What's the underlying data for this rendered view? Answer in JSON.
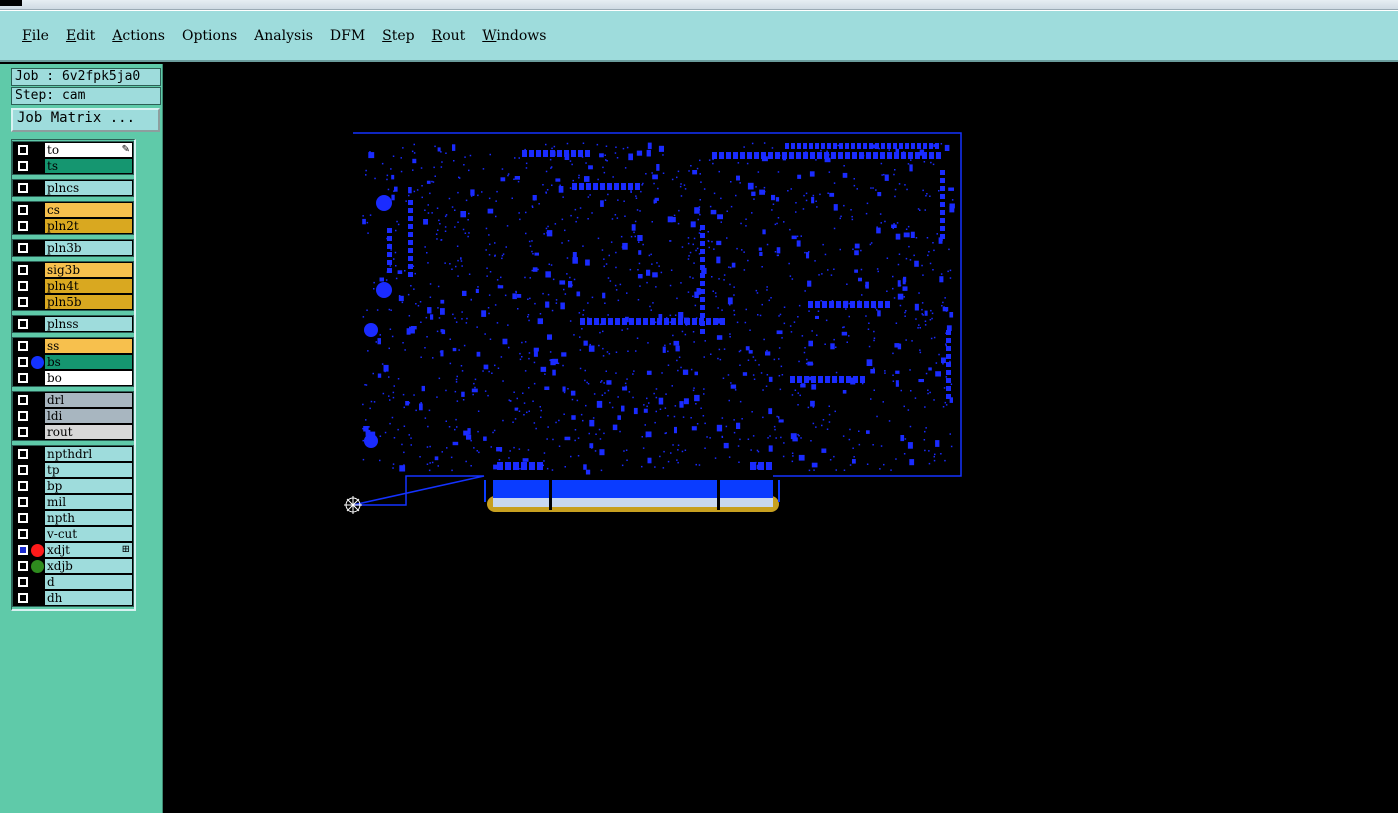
{
  "menu": [
    {
      "label": "File",
      "mnemonic": "F"
    },
    {
      "label": "Edit",
      "mnemonic": "E"
    },
    {
      "label": "Actions",
      "mnemonic": "A"
    },
    {
      "label": "Options",
      "mnemonic": ""
    },
    {
      "label": "Analysis",
      "mnemonic": ""
    },
    {
      "label": "DFM",
      "mnemonic": ""
    },
    {
      "label": "Step",
      "mnemonic": "S"
    },
    {
      "label": "Rout",
      "mnemonic": "R"
    },
    {
      "label": "Windows",
      "mnemonic": "W"
    }
  ],
  "job": {
    "text": "Job : 6v2fpk5ja0"
  },
  "step": {
    "text": "Step: cam"
  },
  "job_matrix_button": "Job Matrix ...",
  "colors": {
    "board_outline": "#1432ff",
    "features": "#1a2bff",
    "finger_gold": "#c7a020",
    "finger_fill": "#0a3cff",
    "finger_light": "#c8d8f0",
    "crosshair": "#ffffff"
  },
  "layer_groups": [
    [
      {
        "name": "to",
        "color": "#ffffff",
        "dot": "",
        "mark": "pen-icon"
      },
      {
        "name": "ts",
        "color": "#159670",
        "dot": ""
      }
    ],
    [
      {
        "name": "plncs",
        "color": "#9edcdc",
        "dot": ""
      }
    ],
    [
      {
        "name": "cs",
        "color": "#f7c04d",
        "dot": ""
      },
      {
        "name": "pln2t",
        "color": "#d9a820",
        "dot": ""
      }
    ],
    [
      {
        "name": "pln3b",
        "color": "#9edcdc",
        "dot": ""
      }
    ],
    [
      {
        "name": "sig3b",
        "color": "#f7c04d",
        "dot": ""
      },
      {
        "name": "pln4t",
        "color": "#d9a820",
        "dot": ""
      },
      {
        "name": "pln5b",
        "color": "#d9a820",
        "dot": ""
      }
    ],
    [
      {
        "name": "plnss",
        "color": "#9edcdc",
        "dot": ""
      }
    ],
    [
      {
        "name": "ss",
        "color": "#f7c04d",
        "dot": ""
      },
      {
        "name": "bs",
        "color": "#159670",
        "dot": "#1432ff"
      },
      {
        "name": "bo",
        "color": "#ffffff",
        "dot": ""
      }
    ],
    [
      {
        "name": "drl",
        "color": "#a8b6c0",
        "dot": ""
      },
      {
        "name": "ldi",
        "color": "#a8b6c0",
        "dot": ""
      },
      {
        "name": "rout",
        "color": "#d8d8d8",
        "dot": ""
      }
    ],
    [
      {
        "name": "npthdrl",
        "color": "#9edcdc",
        "dot": ""
      },
      {
        "name": "tp",
        "color": "#9edcdc",
        "dot": ""
      },
      {
        "name": "bp",
        "color": "#9edcdc",
        "dot": ""
      },
      {
        "name": "mil",
        "color": "#9edcdc",
        "dot": ""
      },
      {
        "name": "npth",
        "color": "#9edcdc",
        "dot": ""
      },
      {
        "name": "v-cut",
        "color": "#9edcdc",
        "dot": ""
      },
      {
        "name": "xdjt",
        "color": "#9edcdc",
        "dot": "#ff1a1a",
        "mark": "grid-icon",
        "active": true
      },
      {
        "name": "xdjb",
        "color": "#9edcdc",
        "dot": "#2e8b1e"
      },
      {
        "name": "d",
        "color": "#9edcdc",
        "dot": ""
      },
      {
        "name": "dh",
        "color": "#9edcdc",
        "dot": ""
      }
    ]
  ]
}
